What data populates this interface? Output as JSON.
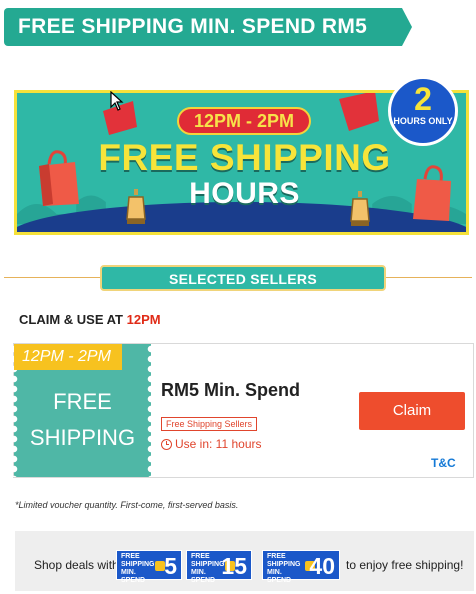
{
  "top_ribbon": {
    "text": "FREE SHIPPING MIN. SPEND RM5"
  },
  "hero": {
    "time_pill": "12PM - 2PM",
    "title_line1": "FREE SHIPPING",
    "title_line2": "HOURS",
    "badge_number": "2",
    "badge_text": "HOURS ONLY"
  },
  "section": {
    "label": "SELECTED SELLERS"
  },
  "claim_header": {
    "prefix": "CLAIM & USE AT ",
    "time": "12PM"
  },
  "voucher": {
    "time_tag": "12PM - 2PM",
    "left_line1": "FREE",
    "left_line2": "SHIPPING",
    "title": "RM5 Min. Spend",
    "tag": "Free Shipping Sellers",
    "use_in": "Use in: 11 hours",
    "claim_label": "Claim",
    "tnc_label": "T&C"
  },
  "disclaimer": "*Limited voucher quantity. First-come, first-served basis.",
  "footer": {
    "left_text": "Shop deals with",
    "right_text": "to enjoy free shipping!",
    "badges": [
      {
        "label": "FREE SHIPPING MIN. SPEND",
        "value": "5"
      },
      {
        "label": "FREE SHIPPING MIN. SPEND",
        "value": "15"
      },
      {
        "label": "FREE SHIPPING MIN. SPEND",
        "value": "40"
      }
    ]
  },
  "colors": {
    "teal": "#24a992",
    "hero_teal": "#2fb8a6",
    "yellow": "#f7e43a",
    "shopee_orange": "#ee4d2d",
    "blue": "#1b58c9",
    "voucher_teal": "#4fb7a6"
  }
}
